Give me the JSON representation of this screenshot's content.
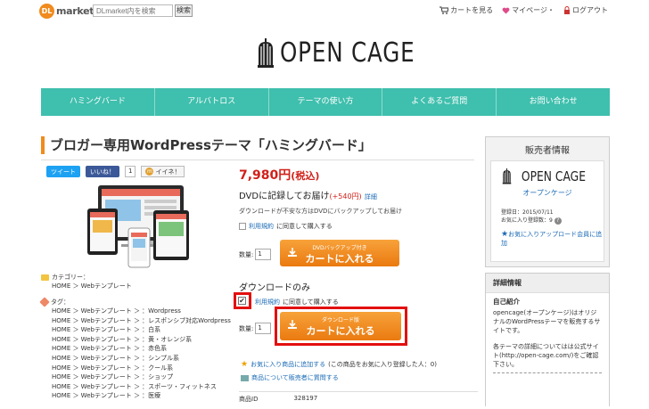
{
  "topbar": {
    "logo_badge": "DL",
    "logo_word": "market",
    "search_placeholder": "DLmarket内を検索",
    "search_button": "検索",
    "cart_link": "カートを見る",
    "mypage_link": "マイページ・",
    "logout_link": "ログアウト"
  },
  "brand": {
    "name": "OPEN CAGE"
  },
  "nav": {
    "tabs": [
      "ハミングバード",
      "アルバトロス",
      "テーマの使い方",
      "よくあるご質問",
      "お問い合わせ"
    ]
  },
  "product": {
    "title": "ブロガー専用WordPressテーマ「ハミングバード」",
    "tweet": "ツイート",
    "like": "いいね！",
    "like_count": "1",
    "iine": "イイネ！",
    "price": "7,980円",
    "price_tax": "(税込)",
    "dvd_title": "DVDに記録してお届け",
    "dvd_plus": "(+540円)",
    "dvd_detail": "詳細",
    "dvd_note": "ダウンロードが不安な方はDVDにバックアップしてお届け",
    "agree_link": "利用規約",
    "agree_text": "に同意して購入する",
    "qty_label": "数量:",
    "qty_value": "1",
    "dvd_button_sub": "DVDバックアップ付き",
    "dvd_button_main": "カートに入れる",
    "dl_only": "ダウンロードのみ",
    "dl_button_sub": "ダウンロード版",
    "dl_button_main": "カートに入れる",
    "fav_link": "お気に入り商品に追加する",
    "fav_note": "(この商品をお気に入り登録した人：0)",
    "inquiry": "商品について販売者に質問する",
    "pid_label": "商品ID",
    "pid_value": "328197"
  },
  "categories": {
    "cat_label": "カテゴリー：",
    "cat_path": "HOME ＞ Webテンプレート",
    "tag_label": "タグ：",
    "tags": [
      "HOME ＞ Webテンプレート ＞ ：Wordpress",
      "HOME ＞ Webテンプレート ＞ ：レスポンシブ対応Wordpress",
      "HOME ＞ Webテンプレート ＞ ：白系",
      "HOME ＞ Webテンプレート ＞ ：黄・オレンジ系",
      "HOME ＞ Webテンプレート ＞ ：赤色系",
      "HOME ＞ Webテンプレート ＞ ：シンプル系",
      "HOME ＞ Webテンプレート ＞ ：クール系",
      "HOME ＞ Webテンプレート ＞ ：ショップ",
      "HOME ＞ Webテンプレート ＞ ：スポーツ・フィットネス",
      "HOME ＞ Webテンプレート ＞ ：医療"
    ]
  },
  "seller": {
    "heading": "販売者情報",
    "brand": "OPEN CAGE",
    "name": "オープンケージ",
    "registered": "登録日：2015/07/11",
    "favorites": "お気に入り登録数：9",
    "fav_link": "お気に入りアップロード会員に追加",
    "details_heading": "詳細情報",
    "intro_heading": "自己紹介",
    "intro_text": "opencage(オープンケージ)はオリジナルのWordPressテーマを販売するサイトです。",
    "intro_text2": "各テーマの詳細についてはは公式サイト(http://open-cage.com/)をご確認下さい。"
  }
}
